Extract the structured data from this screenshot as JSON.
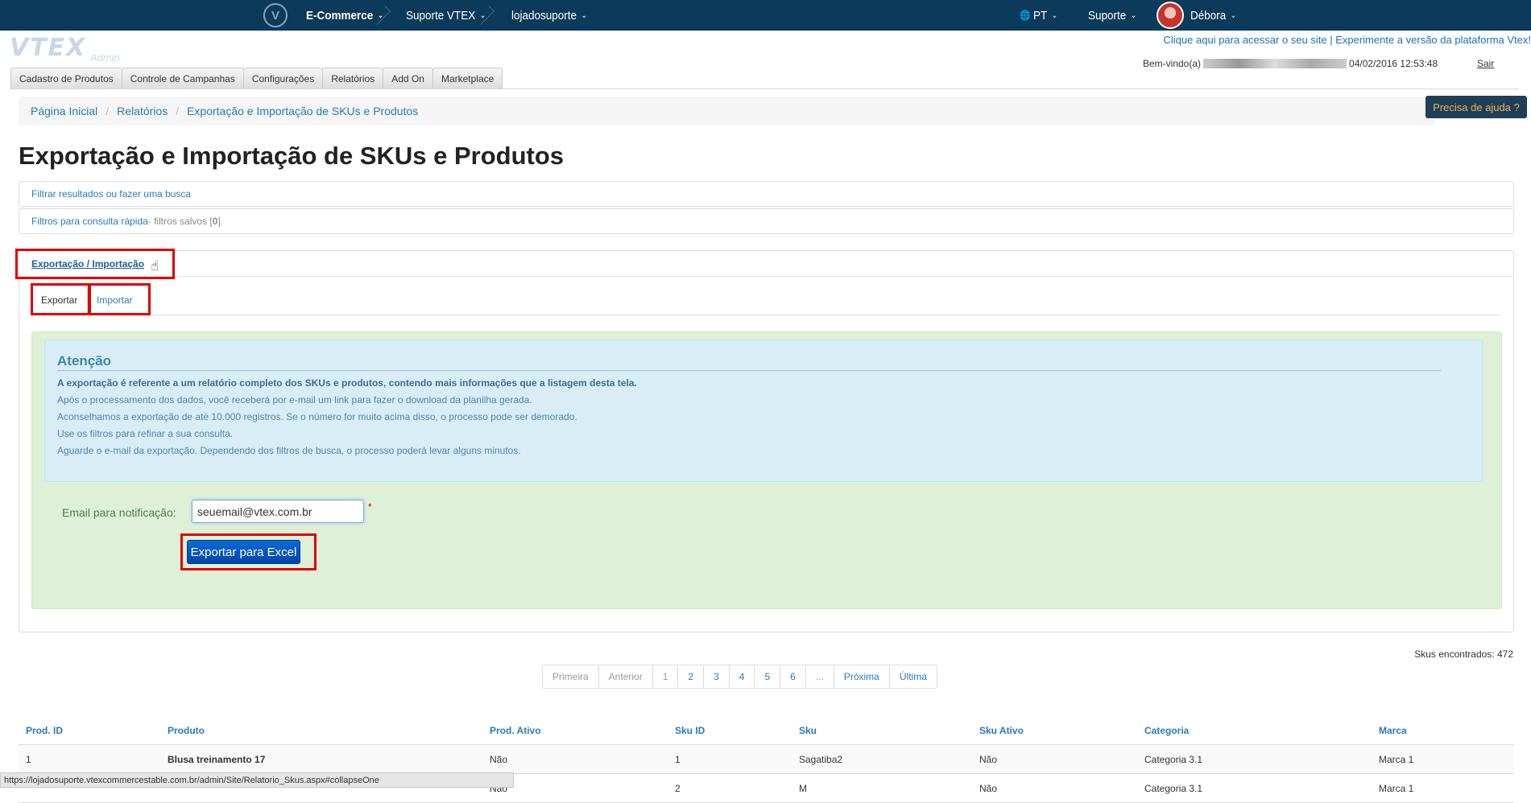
{
  "topbar": {
    "logo_icon": "vtex-v-icon",
    "logo_glyph": "V",
    "ecommerce": "E-Commerce",
    "suporte_vtex": "Suporte VTEX",
    "store": "lojadosuporte",
    "lang_icon": "globe-icon",
    "lang_glyph": "🌐",
    "lang": "PT",
    "support": "Suporte",
    "user": "Débora",
    "caret": "⌄",
    "bg_color": "#0b3a5b"
  },
  "brand": {
    "logo": "VTEX",
    "sub": "Admin"
  },
  "header": {
    "site_link": "Clique aqui para acessar o seu site",
    "divider": " | ",
    "new_version": "Experimente a versão da plataforma Vtex!",
    "welcome": "Bem-vindo(a)",
    "datetime": "04/02/2016 12:53:48",
    "logout": "Sair"
  },
  "main_tabs": [
    "Cadastro de Produtos",
    "Controle de Campanhas",
    "Configurações",
    "Relatórios",
    "Add On",
    "Marketplace"
  ],
  "breadcrumb": [
    "Página Inicial",
    "Relatórios",
    "Exportação e Importação de SKUs e Produtos"
  ],
  "help_button": "Precisa de ajuda ?",
  "page_title": "Exportação e Importação de SKUs e Produtos",
  "filter_bar": "Filtrar resultados ou fazer uma busca",
  "quick_filter": {
    "label": "Filtros para consulta rápida",
    "saved": " - filtros salvos [",
    "count": "0",
    "close": "]"
  },
  "panel": {
    "title": "Exportação / Importação",
    "cursor": "☝",
    "tabs": {
      "export": "Exportar",
      "import": "Importar"
    },
    "alert": {
      "title": "Atenção",
      "strong": "A exportação é referente a um relatório completo dos SKUs e produtos, contendo mais informações que a listagem desta tela.",
      "lines": [
        "Após o processamento dos dados, você receberá por e-mail um link para fazer o download da planilha gerada.",
        "Aconselhamos a exportação de atè 10.000 registros. Se o número for muito acima disso, o processo pode ser demorado.",
        "Use os filtros para refinar a sua consulta.",
        "Aguarde o e-mail da exportação. Dependendo dos filtros de busca, o processo poderá levar alguns minutos."
      ]
    },
    "email_label": "Email para notificação:",
    "email_value": "seuemail@vtex.com.br",
    "required_mark": "*",
    "export_button": "Exportar para Excel",
    "green_bg": "#dff0d8",
    "alert_bg": "#d9edf7"
  },
  "results": {
    "found": "Skus encontrados: 472"
  },
  "pagination": [
    "Primeira",
    "Anterior",
    "1",
    "2",
    "3",
    "4",
    "5",
    "6",
    "...",
    "Próxima",
    "Última"
  ],
  "table": {
    "headers": [
      "Prod. ID",
      "Produto",
      "Prod. Ativo",
      "Sku ID",
      "Sku",
      "Sku Ativo",
      "Categoria",
      "Marca"
    ],
    "rows": [
      [
        "1",
        "Blusa treinamento 17",
        "Não",
        "1",
        "Sagatiba2",
        "Não",
        "Categoria 3.1",
        "Marca 1"
      ],
      [
        "",
        "",
        "Não",
        "2",
        "M",
        "Não",
        "Categoria 3.1",
        "Marca 1"
      ]
    ]
  },
  "statusbar": "https://lojadosuporte.vtexcommercestable.com.br/admin/Site/Relatorio_Skus.aspx#collapseOne",
  "highlight_color": "#e00000"
}
